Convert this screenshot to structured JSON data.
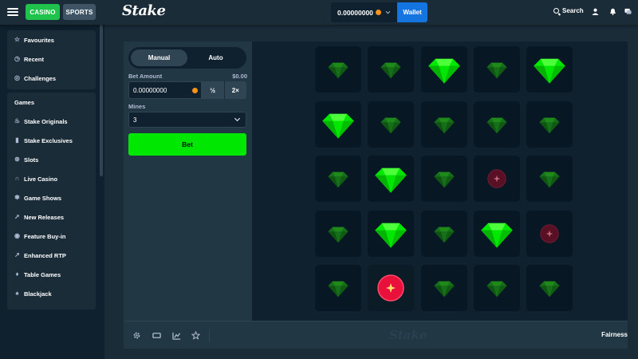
{
  "header": {
    "casino_label": "CASINO",
    "sports_label": "SPORTS",
    "logo_text": "Stake",
    "balance": "0.00000000",
    "wallet_label": "Wallet",
    "search_label": "Search"
  },
  "sidebar": {
    "top_items": [
      {
        "label": "Favourites",
        "icon": "star-icon"
      },
      {
        "label": "Recent",
        "icon": "clock-icon"
      },
      {
        "label": "Challenges",
        "icon": "challenges-icon"
      }
    ],
    "games_header": "Games",
    "game_items": [
      {
        "label": "Stake Originals",
        "icon": "flame-icon"
      },
      {
        "label": "Stake Exclusives",
        "icon": "bookmark-icon"
      },
      {
        "label": "Slots",
        "icon": "slots-icon"
      },
      {
        "label": "Live Casino",
        "icon": "headset-icon"
      },
      {
        "label": "Game Shows",
        "icon": "gameshow-icon"
      },
      {
        "label": "New Releases",
        "icon": "rocket-icon"
      },
      {
        "label": "Feature Buy-in",
        "icon": "target-icon"
      },
      {
        "label": "Enhanced RTP",
        "icon": "rtp-icon"
      },
      {
        "label": "Table Games",
        "icon": "drop-icon"
      },
      {
        "label": "Blackjack",
        "icon": "spade-icon"
      }
    ]
  },
  "controls": {
    "mode_manual": "Manual",
    "mode_auto": "Auto",
    "active_mode": "Manual",
    "bet_amount_label": "Bet Amount",
    "bet_amount_usd": "$0.00",
    "bet_value": "0.00000000",
    "half_label": "½",
    "double_label": "2×",
    "mines_label": "Mines",
    "mines_value": "3",
    "bet_button_label": "Bet"
  },
  "board": {
    "rows": [
      [
        "gem",
        "gem",
        "gem-revealed",
        "gem",
        "gem-revealed"
      ],
      [
        "gem-revealed",
        "gem",
        "gem",
        "gem",
        "gem"
      ],
      [
        "gem",
        "gem-revealed",
        "gem",
        "mine",
        "gem"
      ],
      [
        "gem",
        "gem-revealed",
        "gem",
        "gem-revealed",
        "mine"
      ],
      [
        "gem",
        "mine-exploded",
        "gem",
        "gem",
        "gem"
      ]
    ]
  },
  "footer": {
    "watermark": "Stake",
    "fairness_label": "Fairness"
  },
  "colors": {
    "accent_green": "#00e701",
    "wallet_blue": "#1475e1",
    "casino_green": "#1fc24a",
    "mine_red": "#e9113c"
  }
}
